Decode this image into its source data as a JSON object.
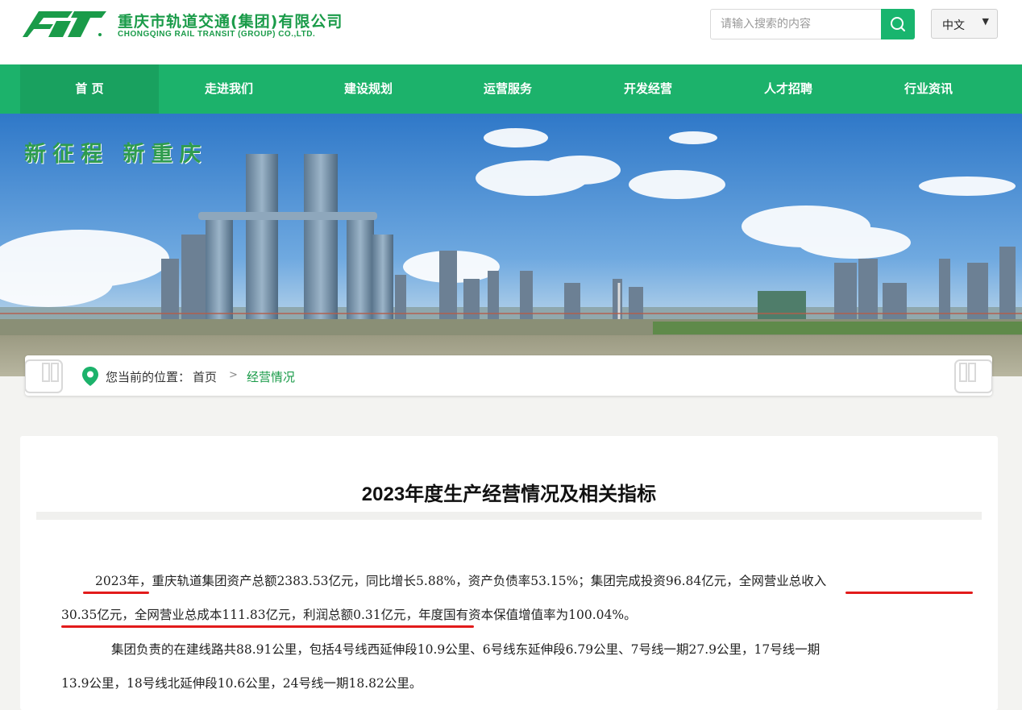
{
  "header": {
    "logo_cn": "重庆市轨道交通(集团)有限公司",
    "logo_en": "CHONGQING RAIL TRANSIT (GROUP) CO.,LTD.",
    "search_placeholder": "请输入搜索的内容",
    "language": "中文",
    "brand_color": "#1a9b49",
    "accent_color": "#1cb26b"
  },
  "nav": {
    "items": [
      "首 页",
      "走进我们",
      "建设规划",
      "运营服务",
      "开发经营",
      "人才招聘",
      "行业资讯"
    ],
    "active_index": 0
  },
  "banner": {
    "slogan": "新征程 新重庆"
  },
  "breadcrumb": {
    "prefix": "您当前的位置：",
    "home": "首页",
    "separator": ">",
    "current": "经营情况"
  },
  "article": {
    "title": "2023年度生产经营情况及相关指标",
    "p1_line1": "2023年，重庆轨道集团资产总额2383.53亿元，同比增长5.88%，资产负债率53.15%；集团完成投资96.84亿元，全网营业总收入",
    "p1_line2": "30.35亿元，全网营业总成本111.83亿元，利润总额0.31亿元，年度国有资本保值增值率为100.04%。",
    "p2_line1": "集团负责的在建线路共88.91公里，包括4号线西延伸段10.9公里、6号线东延伸段6.79公里、7号线一期27.9公里，17号线一期",
    "p2_line2": "13.9公里，18号线北延伸段10.6公里，24号线一期18.82公里。",
    "annotation_color": "#e21b1b"
  }
}
